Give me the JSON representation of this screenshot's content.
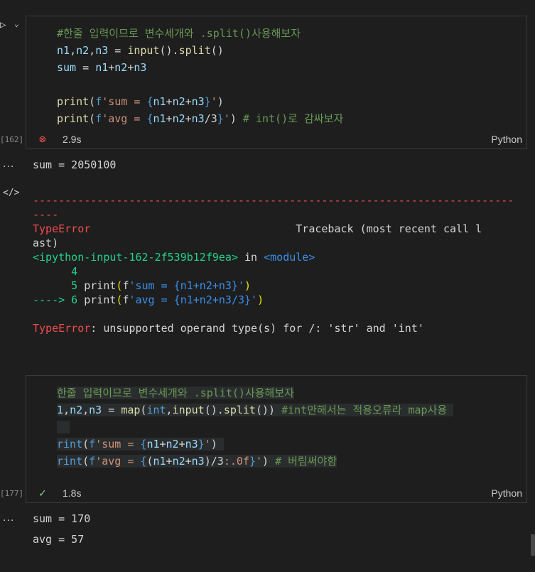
{
  "cell1": {
    "exec_count": "[162]",
    "lines": [
      "#한줄 입력이므로 변수세개와 .split()사용해보자",
      "n1,n2,n3 = input().split()",
      "sum = n1+n2+n3",
      "",
      "print(f'sum = {n1+n2+n3}')",
      "print(f'avg = {n1+n2+n3/3}') # int()로 감싸보자"
    ],
    "status_time": "2.9s",
    "language": "Python"
  },
  "output1": {
    "dots": "...",
    "sum_line": "sum = 2050100",
    "dashes1": "---------------------------------------------------------------------------",
    "dashes2": "----",
    "error_name": "TypeError",
    "traceback_label": "Traceback (most recent call l",
    "traceback_cont": "ast)",
    "input_ref": "<ipython-input-162-2f539b12f9ea>",
    "in_word": " in ",
    "module_ref": "<module>",
    "line4": "      4",
    "line5_no": "      5",
    "line5_code": " print(f'sum = {n1+n2+n3}')",
    "line6_arrow": "----> 6",
    "line6_code": " print(f'avg = {n1+n2+n3/3}')",
    "error_final_name": "TypeError",
    "error_final_msg": ": unsupported operand type(s) for /: 'str' and 'int'"
  },
  "cell2": {
    "exec_count": "[177]",
    "lines": [
      "한줄 입력이므로 변수세개와 .split()사용해보자",
      "1,n2,n3 = map(int,input().split()) #int만해서는 적용오류라 map사용",
      "",
      "rint(f'sum = {n1+n2+n3}')",
      "rint(f'avg = {(n1+n2+n3)/3:.0f}') # 버림써야함"
    ],
    "status_time": "1.8s",
    "language": "Python"
  },
  "output2": {
    "dots": "...",
    "sum_line": "sum = 170",
    "avg_line": "avg = 57"
  },
  "icons": {
    "run": "play-icon",
    "chevron": "chevron-down-icon",
    "error": "error-circle-icon",
    "success": "check-icon",
    "code": "code-icon"
  },
  "colors": {
    "error": "#f14c4c",
    "success": "#89d185",
    "comment": "#6a9955",
    "function": "#dcdcaa",
    "string": "#ce9178",
    "keyword": "#569cd6"
  }
}
